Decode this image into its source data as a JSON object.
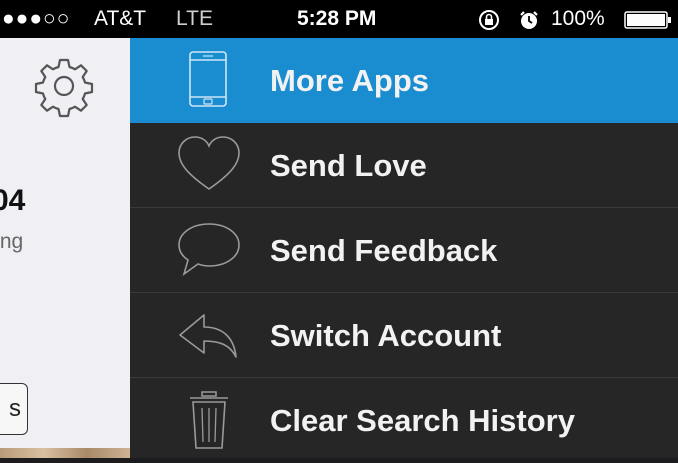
{
  "status_bar": {
    "signal": "●●●○○",
    "carrier": "AT&T",
    "network": "LTE",
    "time": "5:28 PM",
    "battery_percent": "100%",
    "lock_icon": "rotation-lock-icon",
    "alarm_icon": "alarm-clock-icon",
    "battery_icon": "battery-icon"
  },
  "left_panel": {
    "settings_icon": "gear-icon",
    "count_partial": "04",
    "label_partial": "wing",
    "button_partial": "s"
  },
  "menu": {
    "items": [
      {
        "label": "More Apps",
        "icon": "phone-icon",
        "active": true
      },
      {
        "label": "Send Love",
        "icon": "heart-icon",
        "active": false
      },
      {
        "label": "Send Feedback",
        "icon": "speech-bubble-icon",
        "active": false
      },
      {
        "label": "Switch Account",
        "icon": "reply-arrow-icon",
        "active": false
      },
      {
        "label": "Clear Search History",
        "icon": "trash-icon",
        "active": false
      }
    ]
  },
  "colors": {
    "active_item": "#1a8cd0",
    "menu_background": "#262626",
    "status_bar": "#000000"
  }
}
